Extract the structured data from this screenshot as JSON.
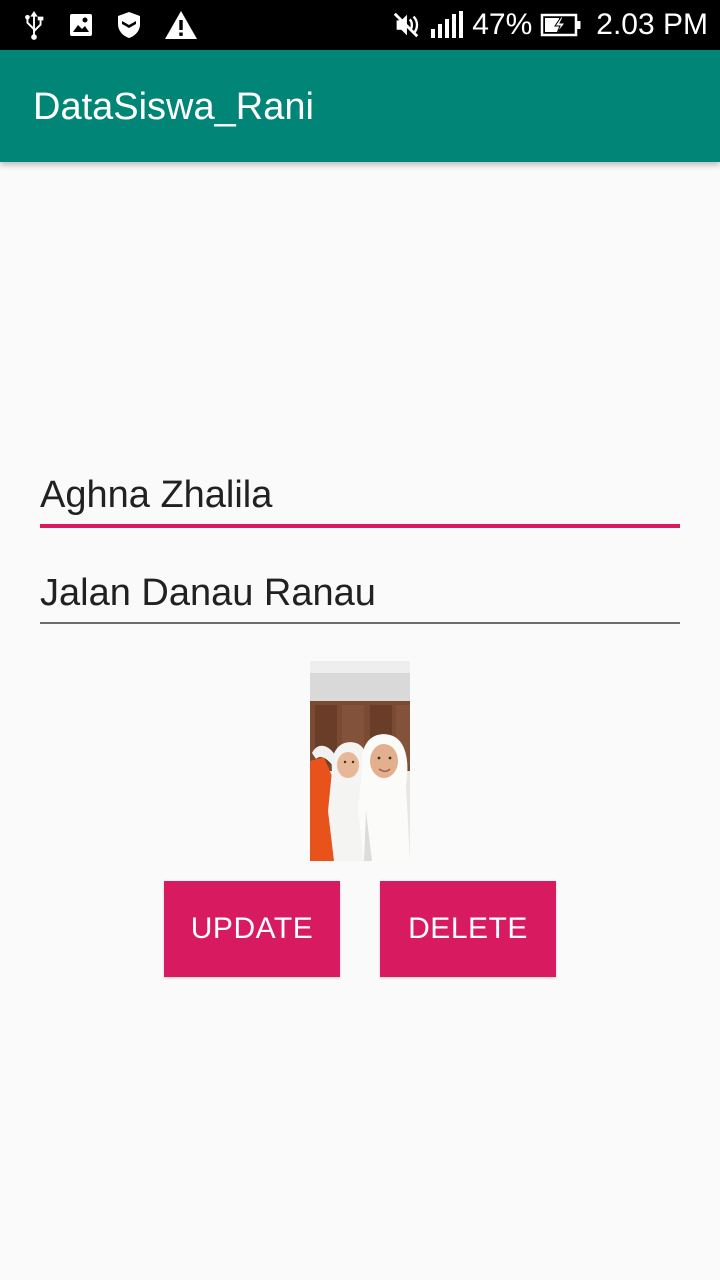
{
  "status_bar": {
    "left_icons": [
      "usb-icon",
      "image-icon",
      "shield-icon",
      "warning-icon"
    ],
    "right_icons": [
      "mute-icon",
      "signal-icon",
      "battery-charging-icon"
    ],
    "battery_text": "47%",
    "time": "2.03 PM"
  },
  "app_bar": {
    "title": "DataSiswa_Rani",
    "color": "#008577"
  },
  "form": {
    "name_value": "Aghna Zhalila",
    "address_value": "Jalan Danau Ranau",
    "accent_color": "#d81b60"
  },
  "photo": {
    "icon": "student-photo"
  },
  "buttons": {
    "update_label": "UPDATE",
    "delete_label": "DELETE",
    "color": "#d81b60"
  }
}
